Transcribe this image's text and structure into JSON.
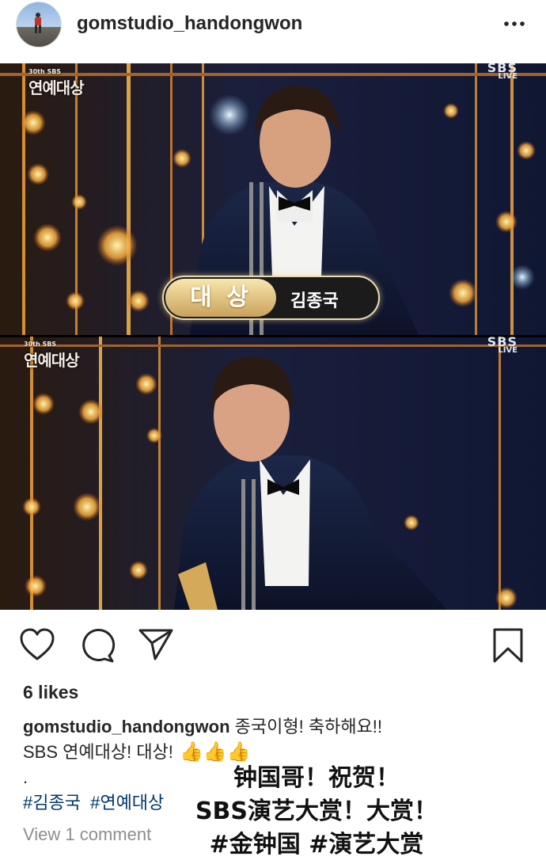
{
  "post": {
    "username": "gomstudio_handongwon",
    "more_icon": "ellipsis-icon",
    "avatar_icon": "avatar"
  },
  "photo": {
    "frame1": {
      "logo_small": "30th SBS",
      "logo_big": "연예대상",
      "broadcast_top": "SBS",
      "broadcast_bottom": "LIVE",
      "award_label": "대 상",
      "award_name": "김종국"
    },
    "frame2": {
      "logo_small": "30th SBS",
      "logo_big": "연예대상",
      "broadcast_top": "SBS",
      "broadcast_bottom": "LIVE"
    }
  },
  "actions": {
    "like_icon": "heart-icon",
    "comment_icon": "comment-icon",
    "share_icon": "send-icon",
    "save_icon": "bookmark-icon"
  },
  "likes": "6 likes",
  "caption": {
    "username": "gomstudio_handongwon",
    "line1": "종국이형! 축하해요!!",
    "line2": "SBS 연예대상! 대상!",
    "emojis": "👍👍👍",
    "dot": "."
  },
  "hashtags": [
    "#김종국",
    "#연예대상"
  ],
  "view_comments": "View 1 comment",
  "overlay": {
    "line1": "钟国哥！祝贺！",
    "line2": "SBS演艺大赏！大赏！",
    "line3": "#金钟国 #演艺大赏"
  }
}
